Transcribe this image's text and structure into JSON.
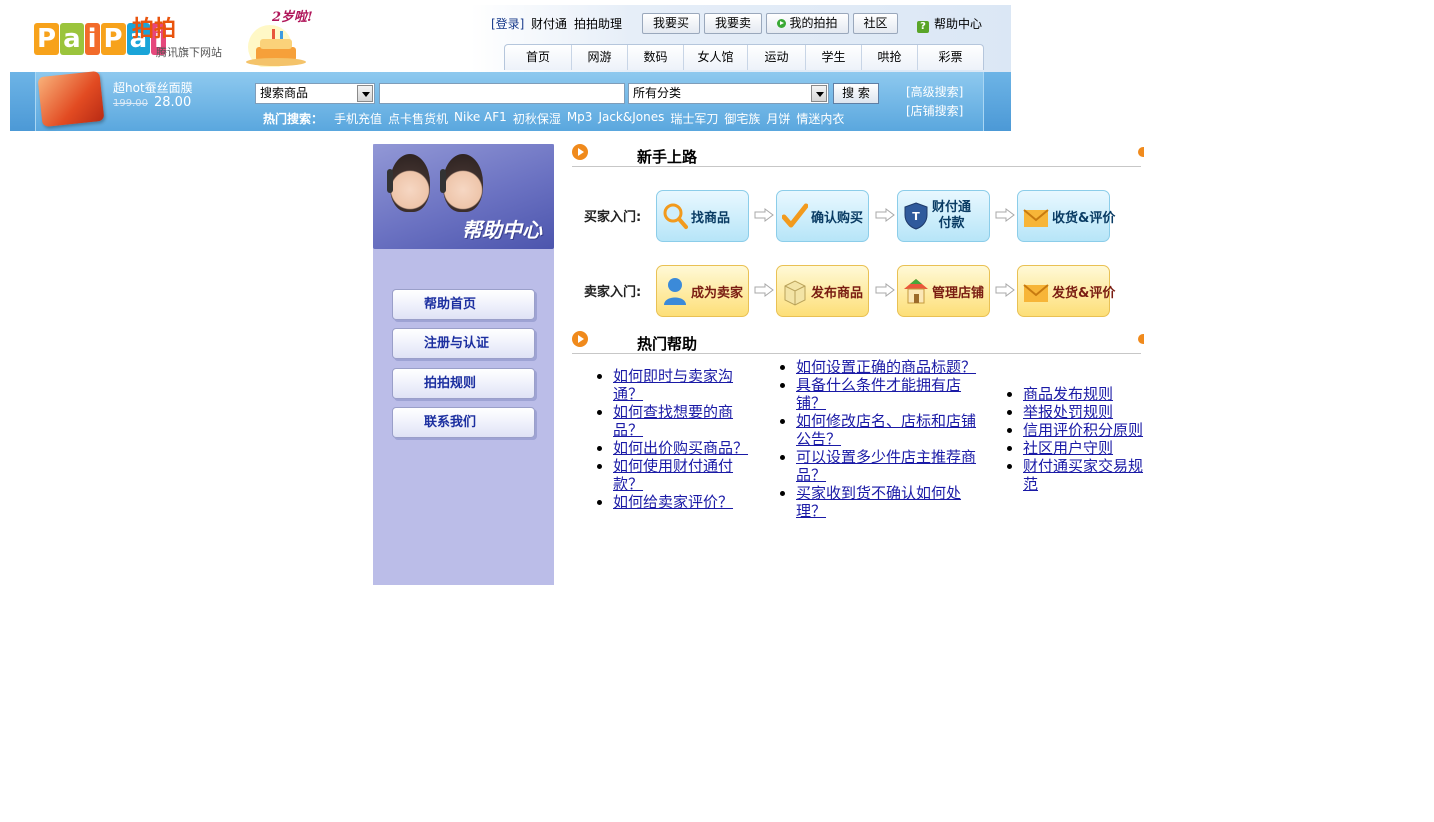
{
  "header": {
    "logo_text": "PaiPai",
    "logo_cn": "拍拍",
    "tagline": "腾讯旗下网站",
    "anniversary": "2岁啦!",
    "top_links": {
      "login": "[登录]",
      "tenpay": "财付通",
      "assistant": "拍拍助理",
      "buy": "我要买",
      "sell": "我要卖",
      "my_paipai": "我的拍拍",
      "community": "社区",
      "help_center": "帮助中心"
    },
    "nav": [
      "首页",
      "网游",
      "数码",
      "女人馆",
      "运动",
      "学生",
      "哄抢",
      "彩票"
    ]
  },
  "promo": {
    "title": "超hot蚕丝面膜",
    "old_price": "199.00",
    "new_price": "28.00"
  },
  "search": {
    "type_selected": "搜索商品",
    "category_selected": "所有分类",
    "keyword": "",
    "button": "搜 索",
    "advanced": "[高级搜索]",
    "shop_search": "[店铺搜索]",
    "hot_label": "热门搜索：",
    "hot_terms": [
      "手机充值",
      "点卡售货机",
      "Nike AF1",
      "初秋保湿",
      "Mp3",
      "Jack&Jones",
      "瑞士军刀",
      "御宅族",
      "月饼",
      "情迷内衣"
    ]
  },
  "sidebar": {
    "banner_title": "帮助中心",
    "buttons": [
      "帮助首页",
      "注册与认证",
      "拍拍规则",
      "联系我们"
    ]
  },
  "beginner": {
    "title": "新手上路",
    "buyer_label": "买家入门:",
    "seller_label": "卖家入门:",
    "buyer_steps": [
      "找商品",
      "确认购买",
      "财付通",
      "付款",
      "收货&评价"
    ],
    "seller_steps": [
      "成为卖家",
      "发布商品",
      "管理店铺",
      "发货&评价"
    ]
  },
  "hot_help": {
    "title": "热门帮助",
    "col1": [
      "如何即时与卖家沟通？",
      "如何查找想要的商品？",
      "如何出价购买商品？",
      "如何使用财付通付款？",
      "如何给卖家评价？"
    ],
    "col2": [
      "如何设置正确的商品标题？",
      "具备什么条件才能拥有店铺？",
      "如何修改店名、店标和店铺公告？",
      "可以设置多少件店主推荐商品？",
      "买家收到货不确认如何处理？"
    ],
    "col3": [
      "商品发布规则",
      "举报处罚规则",
      "信用评价积分原则",
      "社区用户守则",
      "财付通买家交易规范"
    ]
  },
  "colors": {
    "header_blue": "#5aa7de",
    "sidebar_bg": "#bbbde8",
    "link": "#1a1aa6",
    "section_arrow": "#f08a1c"
  }
}
